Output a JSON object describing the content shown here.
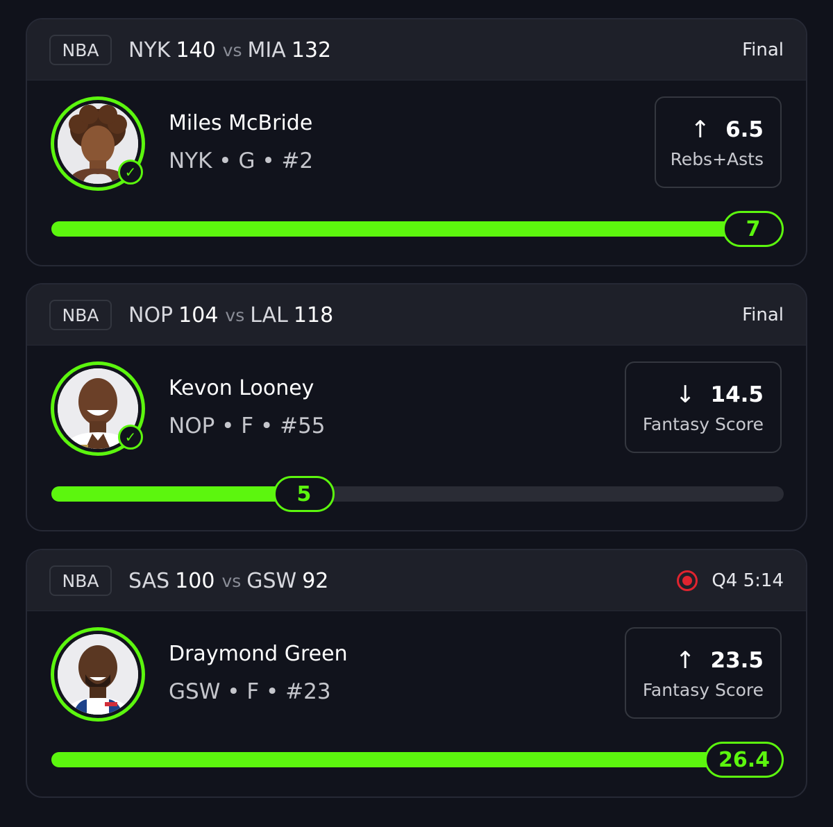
{
  "cards": [
    {
      "league": "NBA",
      "team1": "NYK",
      "score1": "140",
      "vs": "vs",
      "team2": "MIA",
      "score2": "132",
      "status": "Final",
      "player": "Miles McBride",
      "info": "NYK • G • #2",
      "direction": "↑",
      "line": "6.5",
      "stat": "Rebs+Asts",
      "actual": "7",
      "progress_fraction": 1.0
    },
    {
      "league": "NBA",
      "team1": "NOP",
      "score1": "104",
      "vs": "vs",
      "team2": "LAL",
      "score2": "118",
      "status": "Final",
      "player": "Kevon Looney",
      "info": "NOP • F • #55",
      "direction": "↓",
      "line": "14.5",
      "stat": "Fantasy Score",
      "actual": "5",
      "progress_fraction": 0.345
    },
    {
      "league": "NBA",
      "team1": "SAS",
      "score1": "100",
      "vs": "vs",
      "team2": "GSW",
      "score2": "92",
      "status": "Q4 5:14",
      "live": true,
      "player": "Draymond Green",
      "info": "GSW • F • #23",
      "direction": "↑",
      "line": "23.5",
      "stat": "Fantasy Score",
      "actual": "26.4",
      "progress_fraction": 1.0
    }
  ],
  "colors": {
    "accent": "#5cf60e",
    "background": "#10121b",
    "card_header": "#1e2029",
    "live": "#e0242f"
  },
  "icons": {
    "check": "check-circle-icon",
    "arrow_up": "arrow-up-icon",
    "arrow_down": "arrow-down-icon",
    "live": "live-indicator-icon"
  }
}
